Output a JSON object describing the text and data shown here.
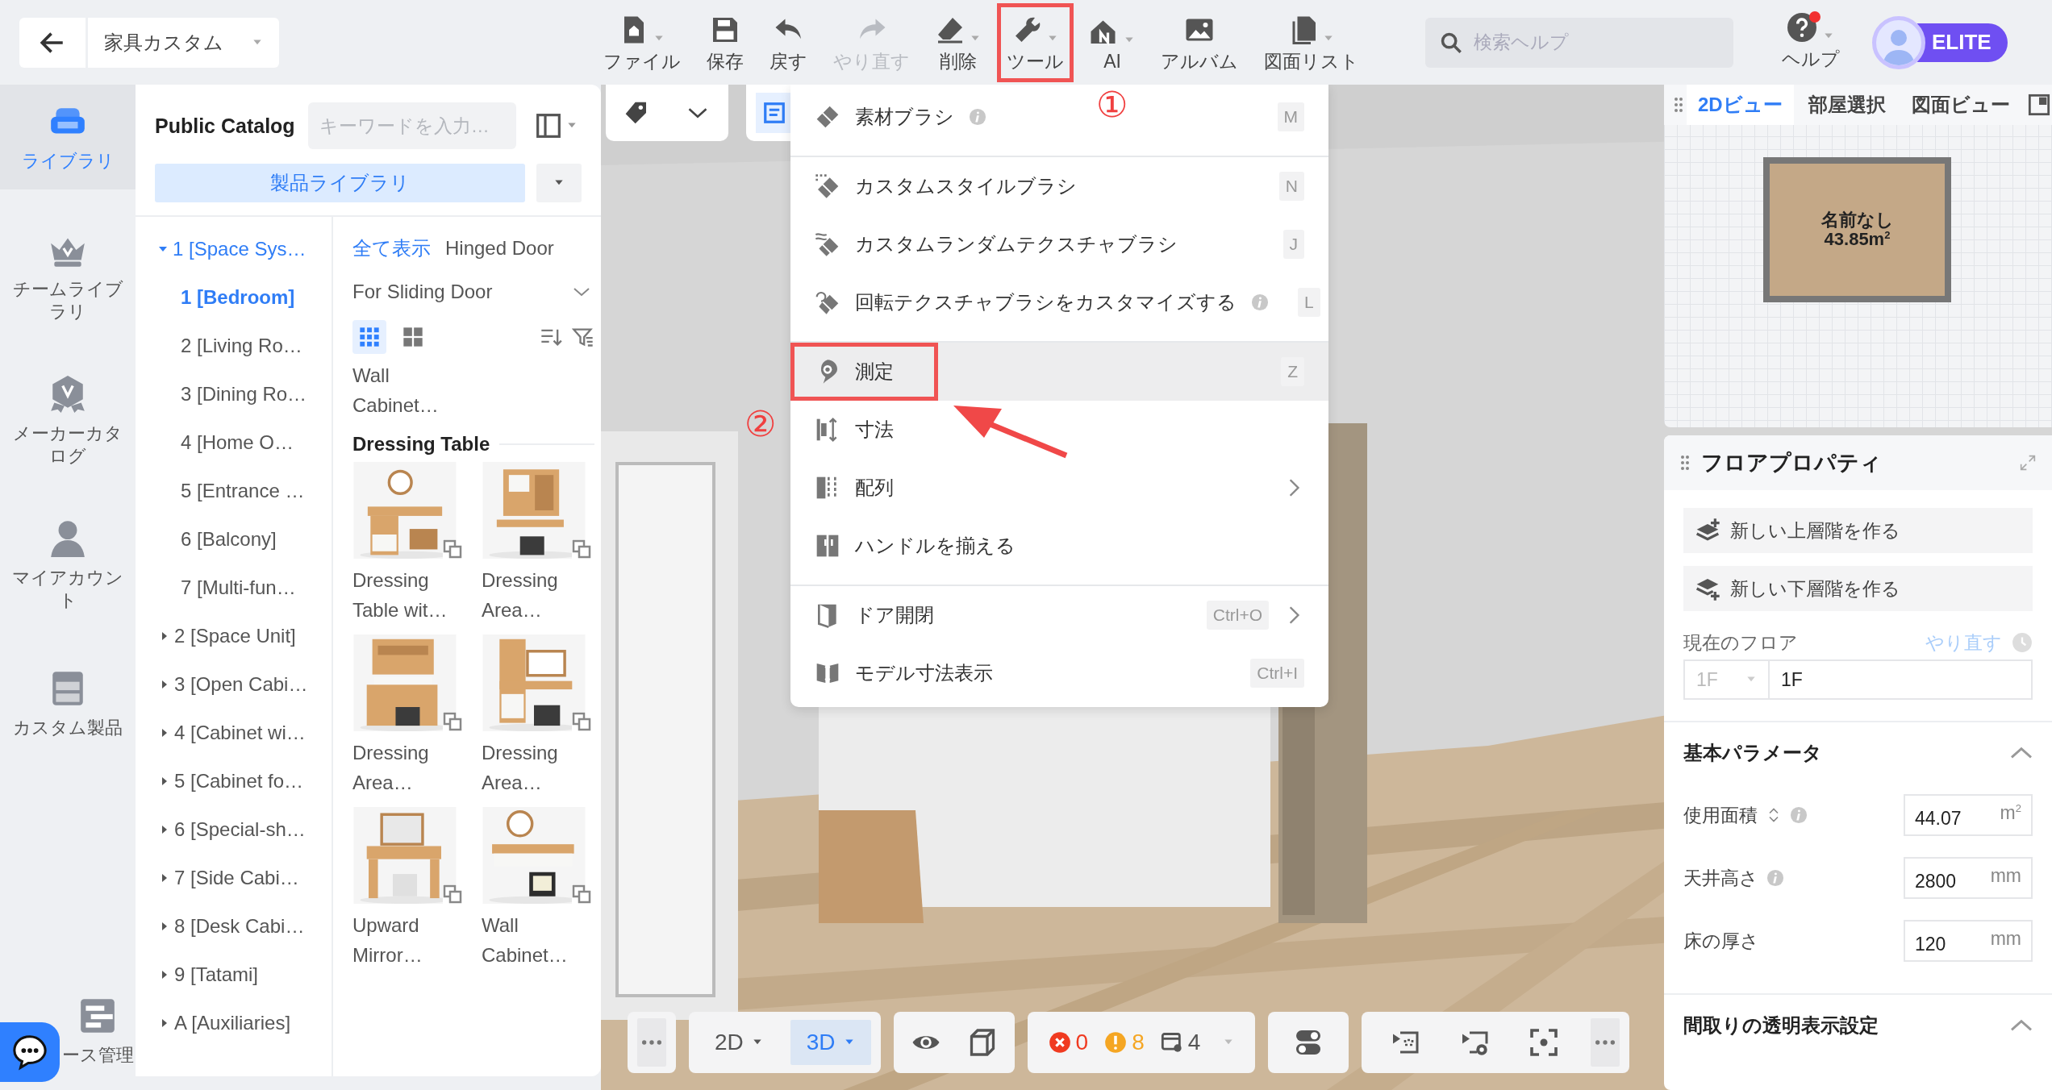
{
  "topbar": {
    "project": "家具カスタム",
    "tools": [
      {
        "kind": "file",
        "label": "ファイル",
        "dropdown": true,
        "disabled": false,
        "outlined": false
      },
      {
        "kind": "save",
        "label": "保存",
        "dropdown": false,
        "disabled": false,
        "outlined": false
      },
      {
        "kind": "undo",
        "label": "戻す",
        "dropdown": false,
        "disabled": false,
        "outlined": false
      },
      {
        "kind": "redo",
        "label": "やり直す",
        "dropdown": false,
        "disabled": true,
        "outlined": false
      },
      {
        "kind": "erase",
        "label": "削除",
        "dropdown": true,
        "disabled": false,
        "outlined": false
      },
      {
        "kind": "tool",
        "label": "ツール",
        "dropdown": true,
        "disabled": false,
        "outlined": true
      },
      {
        "kind": "ai",
        "label": "AI",
        "dropdown": true,
        "disabled": false,
        "outlined": false
      },
      {
        "kind": "album",
        "label": "アルバム",
        "dropdown": false,
        "disabled": false,
        "outlined": false
      },
      {
        "kind": "drawings",
        "label": "図面リスト",
        "dropdown": true,
        "disabled": false,
        "outlined": false
      }
    ],
    "search": {
      "placeholder": "検索ヘルプ"
    },
    "help": {
      "label": "ヘルプ",
      "notification": true
    },
    "plan_badge": "ELITE"
  },
  "sidebar": {
    "items": [
      {
        "kind": "library",
        "label": "ライブラリ",
        "selected": true
      },
      {
        "kind": "team",
        "label": "チームライブラリ",
        "selected": false
      },
      {
        "kind": "maker",
        "label": "メーカーカタログ",
        "selected": false
      },
      {
        "kind": "account",
        "label": "マイアカウント",
        "selected": false
      },
      {
        "kind": "custom",
        "label": "カスタム製品",
        "selected": false
      },
      {
        "kind": "manage",
        "label": "ース管理",
        "selected": false
      }
    ]
  },
  "catalog": {
    "title": "Public Catalog",
    "search": {
      "placeholder": "キーワードを入力…"
    },
    "library_button": "製品ライブラリ",
    "tree": [
      {
        "label": "1 [Space Sys…",
        "expanded": true,
        "children": [
          {
            "label": "1 [Bedroom]",
            "selected": true
          },
          {
            "label": "2 [Living Ro…",
            "selected": false
          },
          {
            "label": "3 [Dining Ro…",
            "selected": false
          },
          {
            "label": "4 [Home O…",
            "selected": false
          },
          {
            "label": "5 [Entrance …",
            "selected": false
          },
          {
            "label": "6 [Balcony]",
            "selected": false
          },
          {
            "label": "7 [Multi-fun…",
            "selected": false
          }
        ]
      },
      {
        "label": "2 [Space Unit]",
        "expanded": false
      },
      {
        "label": "3 [Open Cabi…",
        "expanded": false
      },
      {
        "label": "4 [Cabinet wi…",
        "expanded": false
      },
      {
        "label": "5 [Cabinet fo…",
        "expanded": false
      },
      {
        "label": "6 [Special-sh…",
        "expanded": false
      },
      {
        "label": "7 [Side Cabi…",
        "expanded": false
      },
      {
        "label": "8 [Desk Cabi…",
        "expanded": false
      },
      {
        "label": "9 [Tatami]",
        "expanded": false
      },
      {
        "label": "A [Auxiliaries]",
        "expanded": false
      }
    ],
    "filters": [
      {
        "label": "全て表示",
        "selected": true
      },
      {
        "label": "Hinged Door",
        "selected": false
      },
      {
        "label": "For Sliding Door",
        "selected": false
      }
    ],
    "views": [
      {
        "kind": "small-grid",
        "selected": true
      },
      {
        "kind": "large-grid",
        "selected": false
      }
    ],
    "top_products": [
      {
        "name": "Wall Cabinet…"
      }
    ],
    "section": {
      "title": "Dressing Table",
      "products": [
        {
          "name": "Dressing Table wit…",
          "kind": "picture"
        },
        {
          "name": "Dressing Area…",
          "kind": "picture"
        },
        {
          "name": "Dressing Area…",
          "kind": "picture"
        },
        {
          "name": "Dressing Area…",
          "kind": "picture"
        },
        {
          "name": "Upward Mirror…",
          "kind": "picture"
        },
        {
          "name": "Wall Cabinet…",
          "kind": "picture"
        }
      ]
    }
  },
  "menu": {
    "items": [
      {
        "kind": "material-brush",
        "label": "素材ブラシ",
        "info": true,
        "shortcut": "M",
        "submenu": false,
        "divider": true,
        "selected": false,
        "outlined": false
      },
      {
        "kind": "style-brush",
        "label": "カスタムスタイルブラシ",
        "info": false,
        "shortcut": "N",
        "submenu": false,
        "divider": false,
        "selected": false,
        "outlined": false
      },
      {
        "kind": "random-brush",
        "label": "カスタムランダムテクスチャブラシ",
        "info": false,
        "shortcut": "J",
        "submenu": false,
        "divider": false,
        "selected": false,
        "outlined": false
      },
      {
        "kind": "rotate-brush",
        "label": "回転テクスチャブラシをカスタマイズする",
        "info": true,
        "shortcut": "L",
        "submenu": false,
        "divider": true,
        "selected": false,
        "outlined": false
      },
      {
        "kind": "measure",
        "label": "測定",
        "info": false,
        "shortcut": "Z",
        "submenu": false,
        "divider": false,
        "selected": true,
        "outlined": true
      },
      {
        "kind": "dimension",
        "label": "寸法",
        "info": false,
        "submenu": false,
        "divider": false,
        "selected": false,
        "outlined": false
      },
      {
        "kind": "array",
        "label": "配列",
        "info": false,
        "submenu": true,
        "divider": false,
        "selected": false,
        "outlined": false
      },
      {
        "kind": "handle",
        "label": "ハンドルを揃える",
        "info": false,
        "submenu": false,
        "divider": true,
        "selected": false,
        "outlined": false
      },
      {
        "kind": "door",
        "label": "ドア開閉",
        "info": false,
        "shortcut": "Ctrl+O",
        "submenu": true,
        "divider": false,
        "selected": false,
        "outlined": false
      },
      {
        "kind": "model-dimension",
        "label": "モデル寸法表示",
        "info": false,
        "shortcut": "Ctrl+I",
        "submenu": false,
        "divider": false,
        "selected": false,
        "outlined": false
      }
    ]
  },
  "annotations": [
    {
      "label": "①"
    },
    {
      "label": "②"
    }
  ],
  "plan_view": {
    "tabs": [
      {
        "label": "2Dビュー",
        "selected": true
      },
      {
        "label": "部屋選択",
        "selected": false
      },
      {
        "label": "図面ビュー",
        "selected": false
      }
    ],
    "room": {
      "name": "名前なし",
      "area": "43.85m$^{2}$"
    }
  },
  "floor_properties": {
    "title": "フロアプロパティ",
    "actions": [
      {
        "kind": "up",
        "label": "新しい上層階を作る"
      },
      {
        "kind": "down",
        "label": "新しい下層階を作る"
      }
    ],
    "current_floor": {
      "label": "現在のフロア",
      "redo": {
        "label": "やり直す",
        "disabled": true
      },
      "select": {
        "value": "1F",
        "disabled": true
      },
      "input": "1F"
    },
    "sections": [
      {
        "title": "基本パラメータ",
        "expanded": true,
        "fields": [
          {
            "label": "使用面積",
            "sortable": true,
            "info": true,
            "value": "44.07",
            "unit": "m$^{2}$"
          },
          {
            "label": "天井高さ",
            "sortable": false,
            "info": true,
            "value": "2800",
            "unit": "mm"
          },
          {
            "label": "床の厚さ",
            "sortable": false,
            "info": false,
            "value": "120",
            "unit": "mm"
          }
        ]
      },
      {
        "title": "間取りの透明表示設定",
        "expanded": true
      }
    ]
  },
  "bottom_toolbar": {
    "modes": [
      {
        "label": "2D",
        "selected": false
      },
      {
        "label": "3D",
        "selected": true
      }
    ],
    "errors": "0",
    "warnings": "8",
    "models": "4"
  }
}
